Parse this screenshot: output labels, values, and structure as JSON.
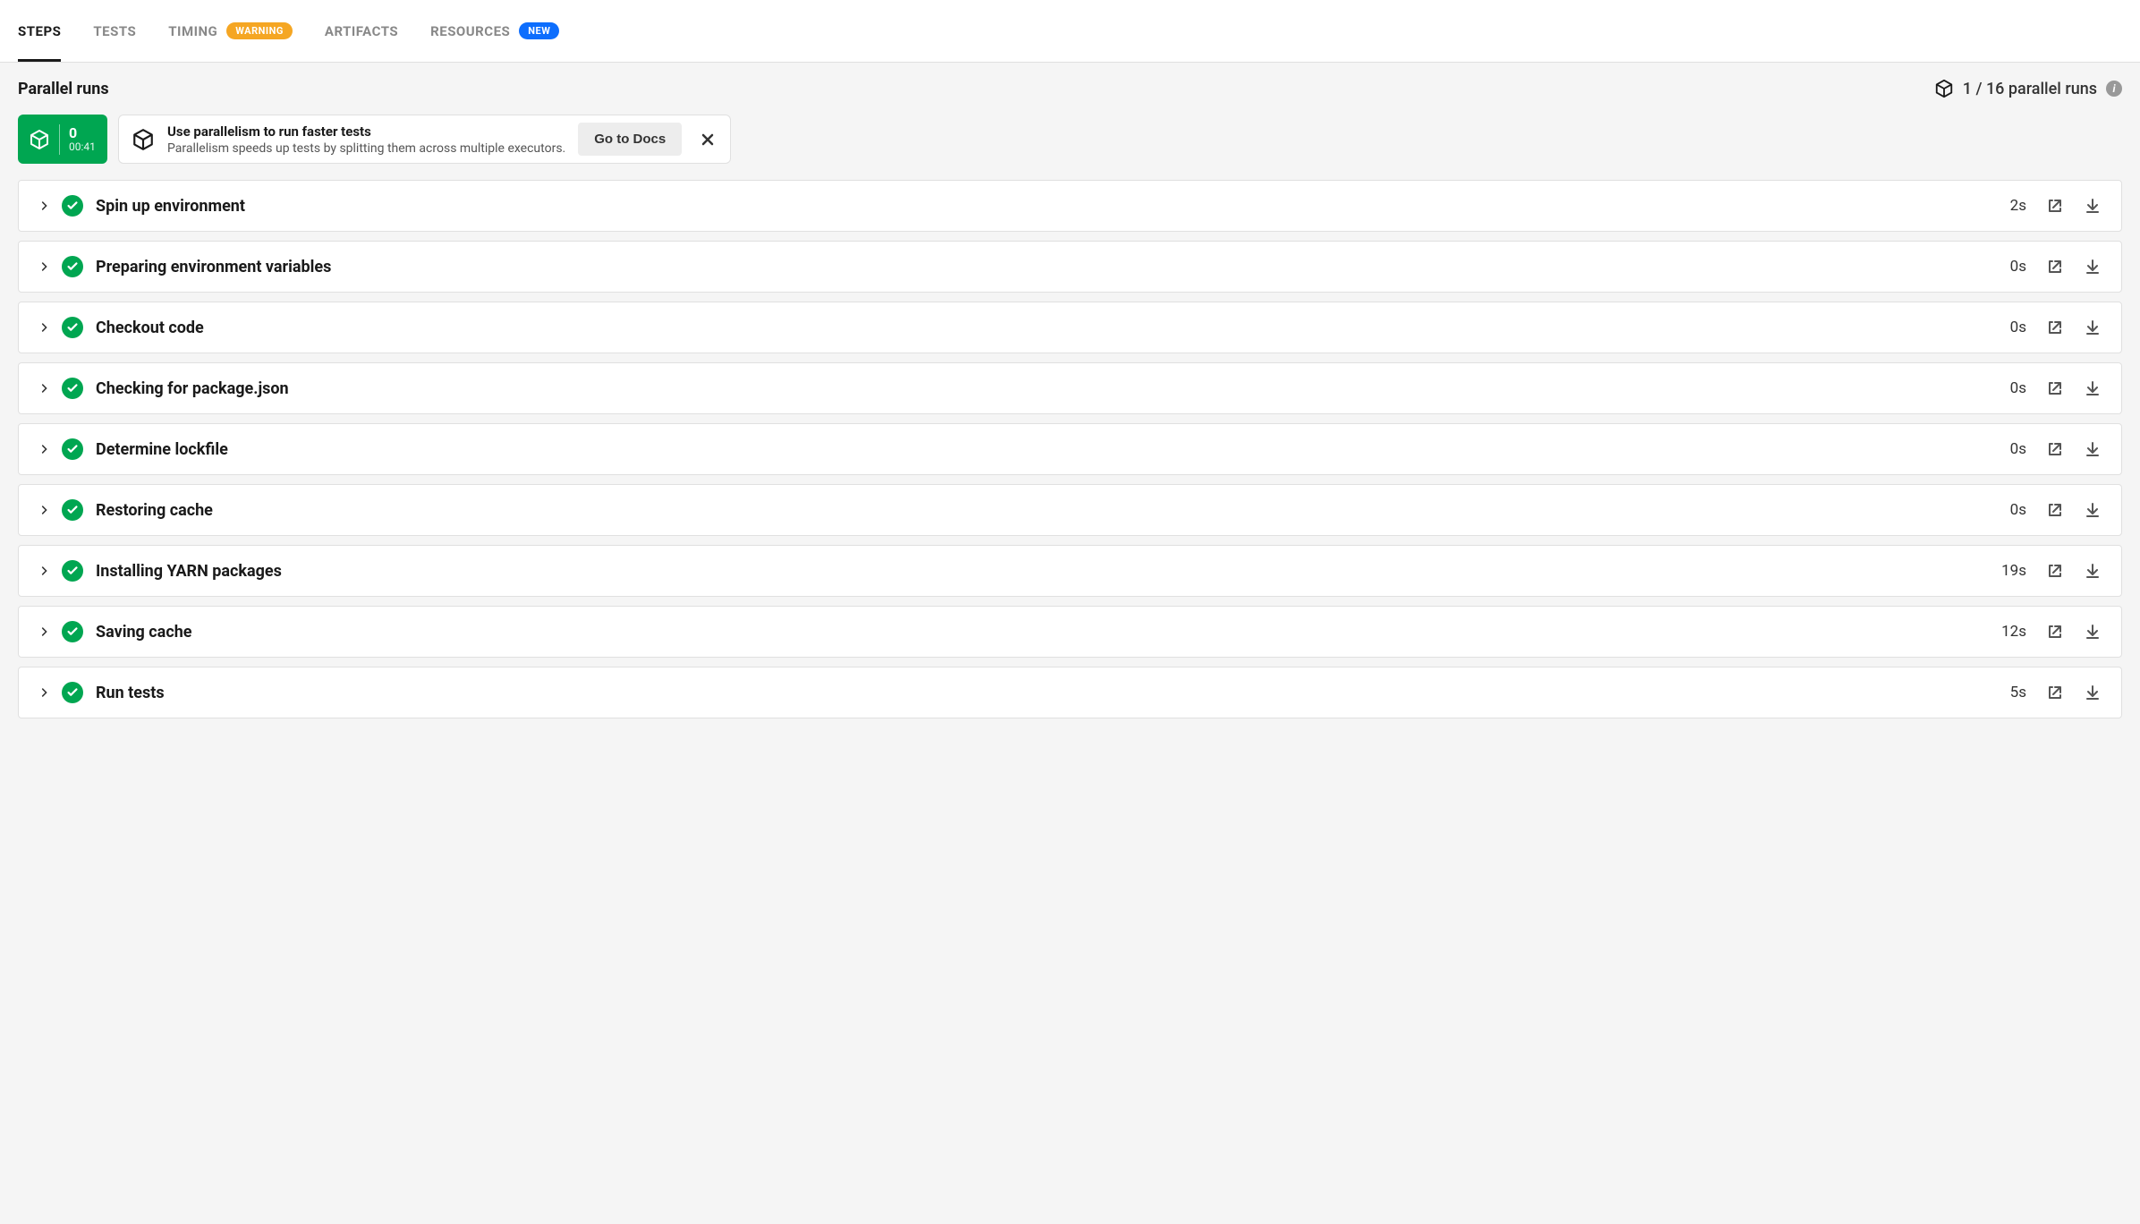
{
  "tabs": {
    "steps": "STEPS",
    "tests": "TESTS",
    "timing": "TIMING",
    "timing_badge": "WARNING",
    "artifacts": "ARTIFACTS",
    "resources": "RESOURCES",
    "resources_badge": "NEW"
  },
  "section_title": "Parallel runs",
  "runs_count_label": "1 / 16 parallel runs",
  "run_card": {
    "index": "0",
    "duration": "00:41"
  },
  "promo": {
    "title": "Use parallelism to run faster tests",
    "subtitle": "Parallelism speeds up tests by splitting them across multiple executors.",
    "button": "Go to Docs"
  },
  "steps": [
    {
      "name": "Spin up environment",
      "duration": "2s"
    },
    {
      "name": "Preparing environment variables",
      "duration": "0s"
    },
    {
      "name": "Checkout code",
      "duration": "0s"
    },
    {
      "name": "Checking for package.json",
      "duration": "0s"
    },
    {
      "name": "Determine lockfile",
      "duration": "0s"
    },
    {
      "name": "Restoring cache",
      "duration": "0s"
    },
    {
      "name": "Installing YARN packages",
      "duration": "19s"
    },
    {
      "name": "Saving cache",
      "duration": "12s"
    },
    {
      "name": "Run tests",
      "duration": "5s"
    }
  ]
}
